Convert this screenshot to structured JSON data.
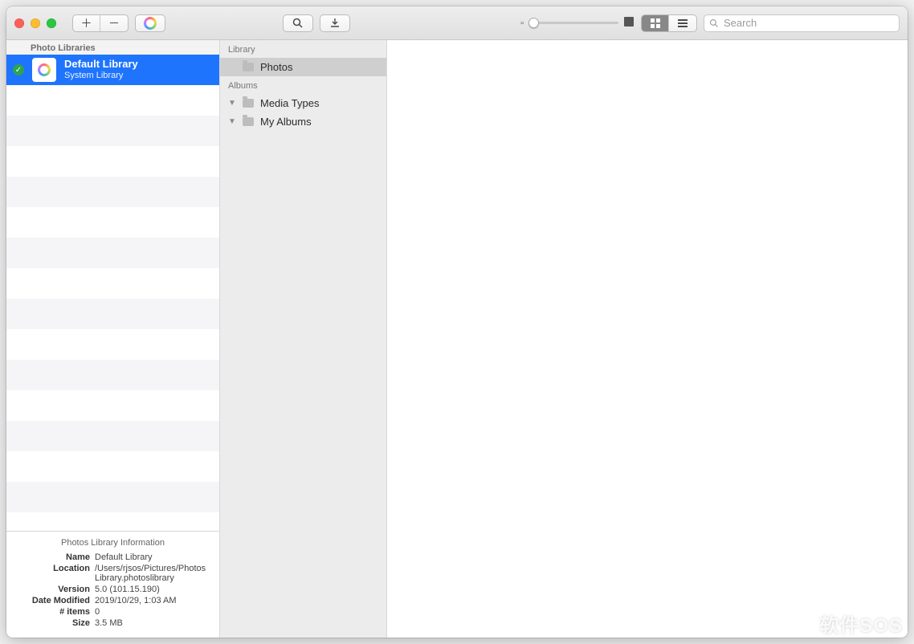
{
  "toolbar": {
    "search_placeholder": "Search"
  },
  "left": {
    "header": "Photo Libraries",
    "selected": {
      "title": "Default Library",
      "subtitle": "System Library"
    },
    "info_title": "Photos Library Information",
    "info_rows": [
      {
        "key": "Name",
        "value": "Default Library"
      },
      {
        "key": "Location",
        "value": "/Users/rjsos/Pictures/Photos Library.photoslibrary"
      },
      {
        "key": "Version",
        "value": "5.0 (101.15.190)"
      },
      {
        "key": "Date Modified",
        "value": "2019/10/29, 1:03 AM"
      },
      {
        "key": "# items",
        "value": "0"
      },
      {
        "key": "Size",
        "value": "3.5 MB"
      }
    ]
  },
  "middle": {
    "library_header": "Library",
    "photos_label": "Photos",
    "albums_header": "Albums",
    "media_types_label": "Media Types",
    "my_albums_label": "My Albums"
  },
  "watermark": "软件SOS"
}
